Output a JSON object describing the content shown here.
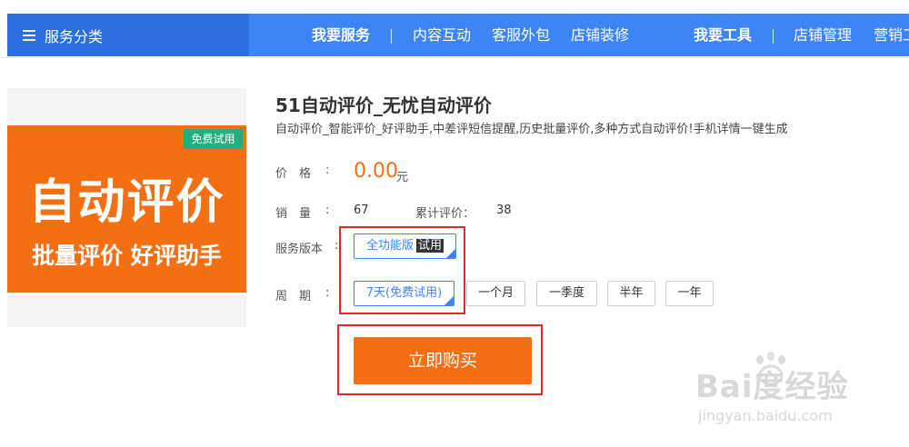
{
  "nav": {
    "category_button": "服务分类",
    "items": [
      {
        "label": "我要服务",
        "bold": true
      },
      {
        "label": "内容互动"
      },
      {
        "label": "客服外包"
      },
      {
        "label": "店铺装修"
      },
      {
        "label": "我要工具",
        "bold": true
      },
      {
        "label": "店铺管理"
      },
      {
        "label": "营销工"
      }
    ]
  },
  "product": {
    "image": {
      "free_tag": "免费试用",
      "big_text": "自动评价",
      "sub_text": "批量评价 好评助手"
    },
    "title": "51自动评价_无忧自动评价",
    "description": "自动评价_智能评价_好评助手,中差评短信提醒,历史批量评价,多种方式自动评价!手机详情一键生成",
    "price_label": "价　格",
    "price": "0.00",
    "price_unit": "元",
    "sales_label": "销　量",
    "sales": "67",
    "reviews_label": "累计评价：",
    "reviews": "38",
    "version_label": "服务版本",
    "version_option": "全功能版",
    "version_trial": "试用",
    "period_label": "周　期",
    "periods": [
      "7天(免费试用)",
      "一个月",
      "一季度",
      "半年",
      "一年"
    ],
    "buy_button": "立即购买"
  },
  "watermark": {
    "main": "Bai度经验",
    "sub": "jingyan.baidu.com"
  },
  "colors": {
    "nav_blue": "#3d84f5",
    "nav_dark": "#2b6ee0",
    "orange": "#f46f14",
    "green_tag": "#23b07f",
    "highlight_red": "#e02828"
  }
}
